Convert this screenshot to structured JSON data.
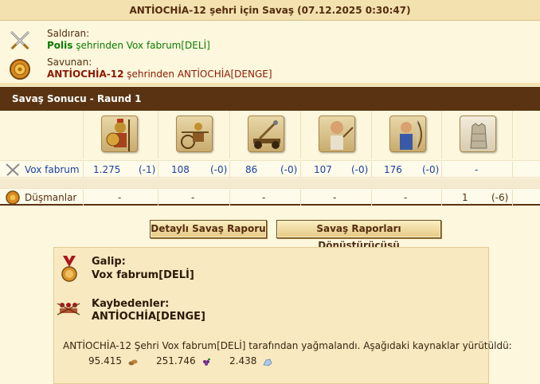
{
  "title": "ANTİOCHİA-12 şehri için Savaş (07.12.2025 0:30:47)",
  "attacker": {
    "label": "Saldıran:",
    "city": "Polis",
    "from_text": "şehrinden Vox fabrum[DELİ]"
  },
  "defender": {
    "label": "Savunan:",
    "city": "ANTİOCHİA-12",
    "from_text": "şehrinden ANTİOCHİA[DENGE]"
  },
  "result_header": "Savaş Sonucu - Raund 1",
  "units": [
    {
      "icon": "hoplite-icon"
    },
    {
      "icon": "chariot-icon"
    },
    {
      "icon": "catapult-icon"
    },
    {
      "icon": "slinger-icon"
    },
    {
      "icon": "archer-icon"
    },
    {
      "icon": "city-wall-icon"
    }
  ],
  "rows": {
    "attacker": {
      "name": "Vox fabrum",
      "cells": [
        {
          "count": "1.275",
          "loss": "(-1)"
        },
        {
          "count": "108",
          "loss": "(-0)"
        },
        {
          "count": "86",
          "loss": "(-0)"
        },
        {
          "count": "107",
          "loss": "(-0)"
        },
        {
          "count": "176",
          "loss": "(-0)"
        },
        {
          "count": "-",
          "loss": ""
        }
      ]
    },
    "defender": {
      "name": "Düşmanlar",
      "cells": [
        {
          "count": "-",
          "loss": ""
        },
        {
          "count": "-",
          "loss": ""
        },
        {
          "count": "-",
          "loss": ""
        },
        {
          "count": "-",
          "loss": ""
        },
        {
          "count": "-",
          "loss": ""
        },
        {
          "count": "1",
          "loss": "(-6)"
        }
      ]
    }
  },
  "buttons": {
    "detailed": "Detaylı Savaş Raporu",
    "converter": "Savaş Raporları Dönüştürücüsü"
  },
  "summary": {
    "winner_label": "Galip:",
    "winner": "Vox fabrum[DELİ]",
    "loser_label": "Kaybedenler:",
    "loser": "ANTİOCHİA[DENGE]",
    "message": "ANTİOCHİA-12 Şehri Vox fabrum[DELİ] tarafından yağmalandı. Aşağıdaki kaynaklar yürütüldü:",
    "resources": [
      {
        "value": "95.415",
        "icon": "wood-icon"
      },
      {
        "value": "251.746",
        "icon": "grapes-icon"
      },
      {
        "value": "2.438",
        "icon": "marble-icon"
      }
    ]
  }
}
